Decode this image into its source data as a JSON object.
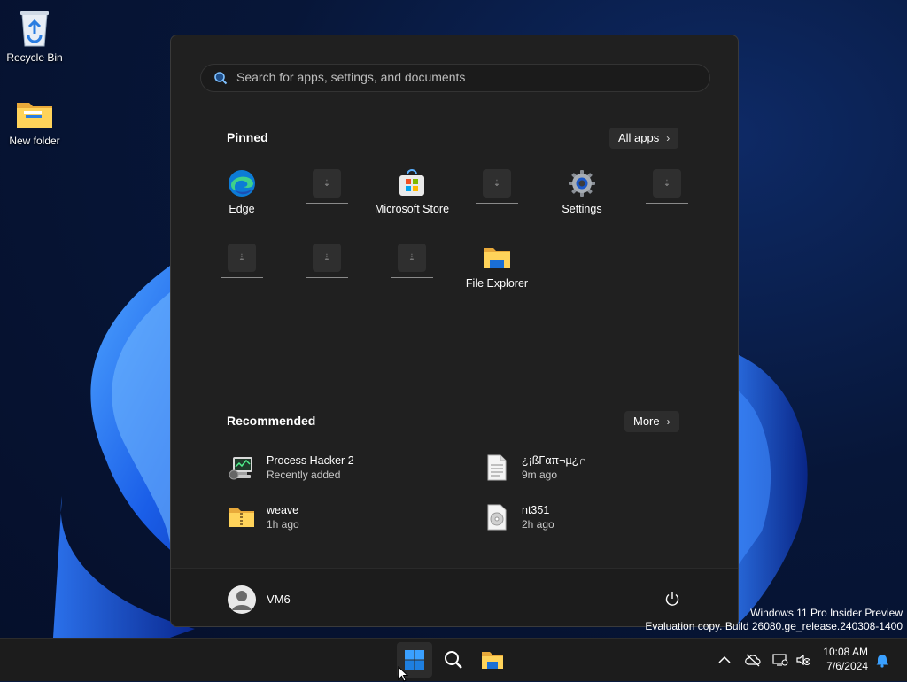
{
  "desktop": {
    "icons": [
      {
        "label": "Recycle Bin"
      },
      {
        "label": "New folder"
      }
    ]
  },
  "start_menu": {
    "search": {
      "placeholder": "Search for apps, settings, and documents"
    },
    "pinned": {
      "title": "Pinned",
      "all_apps_label": "All apps",
      "apps": [
        {
          "label": "Edge",
          "icon": "edge-icon"
        },
        {
          "label": "",
          "icon": "placeholder-icon"
        },
        {
          "label": "Microsoft Store",
          "icon": "store-icon"
        },
        {
          "label": "",
          "icon": "placeholder-icon"
        },
        {
          "label": "Settings",
          "icon": "gear-icon"
        },
        {
          "label": "",
          "icon": "placeholder-icon"
        },
        {
          "label": "",
          "icon": "placeholder-icon"
        },
        {
          "label": "",
          "icon": "placeholder-icon"
        },
        {
          "label": "",
          "icon": "placeholder-icon"
        },
        {
          "label": "File Explorer",
          "icon": "file-explorer-icon"
        }
      ]
    },
    "recommended": {
      "title": "Recommended",
      "more_label": "More",
      "items": [
        {
          "name": "Process Hacker 2",
          "detail": "Recently added",
          "icon": "process-hacker-icon"
        },
        {
          "name": "¿¡ßΓαπ¬µ¿∩",
          "detail": "9m ago",
          "icon": "document-icon"
        },
        {
          "name": "weave",
          "detail": "1h ago",
          "icon": "zip-folder-icon"
        },
        {
          "name": "nt351",
          "detail": "2h ago",
          "icon": "disc-image-icon"
        }
      ]
    },
    "user": {
      "name": "VM6"
    }
  },
  "watermark": {
    "line1": "Windows 11 Pro Insider Preview",
    "line2": "Evaluation copy. Build 26080.ge_release.240308-1400"
  },
  "taskbar": {
    "clock": {
      "time": "10:08 AM",
      "date": "7/6/2024"
    }
  },
  "colors": {
    "menu_bg": "#202020",
    "taskbar_bg": "#1c1c1c",
    "accent": "#0a84ff"
  }
}
